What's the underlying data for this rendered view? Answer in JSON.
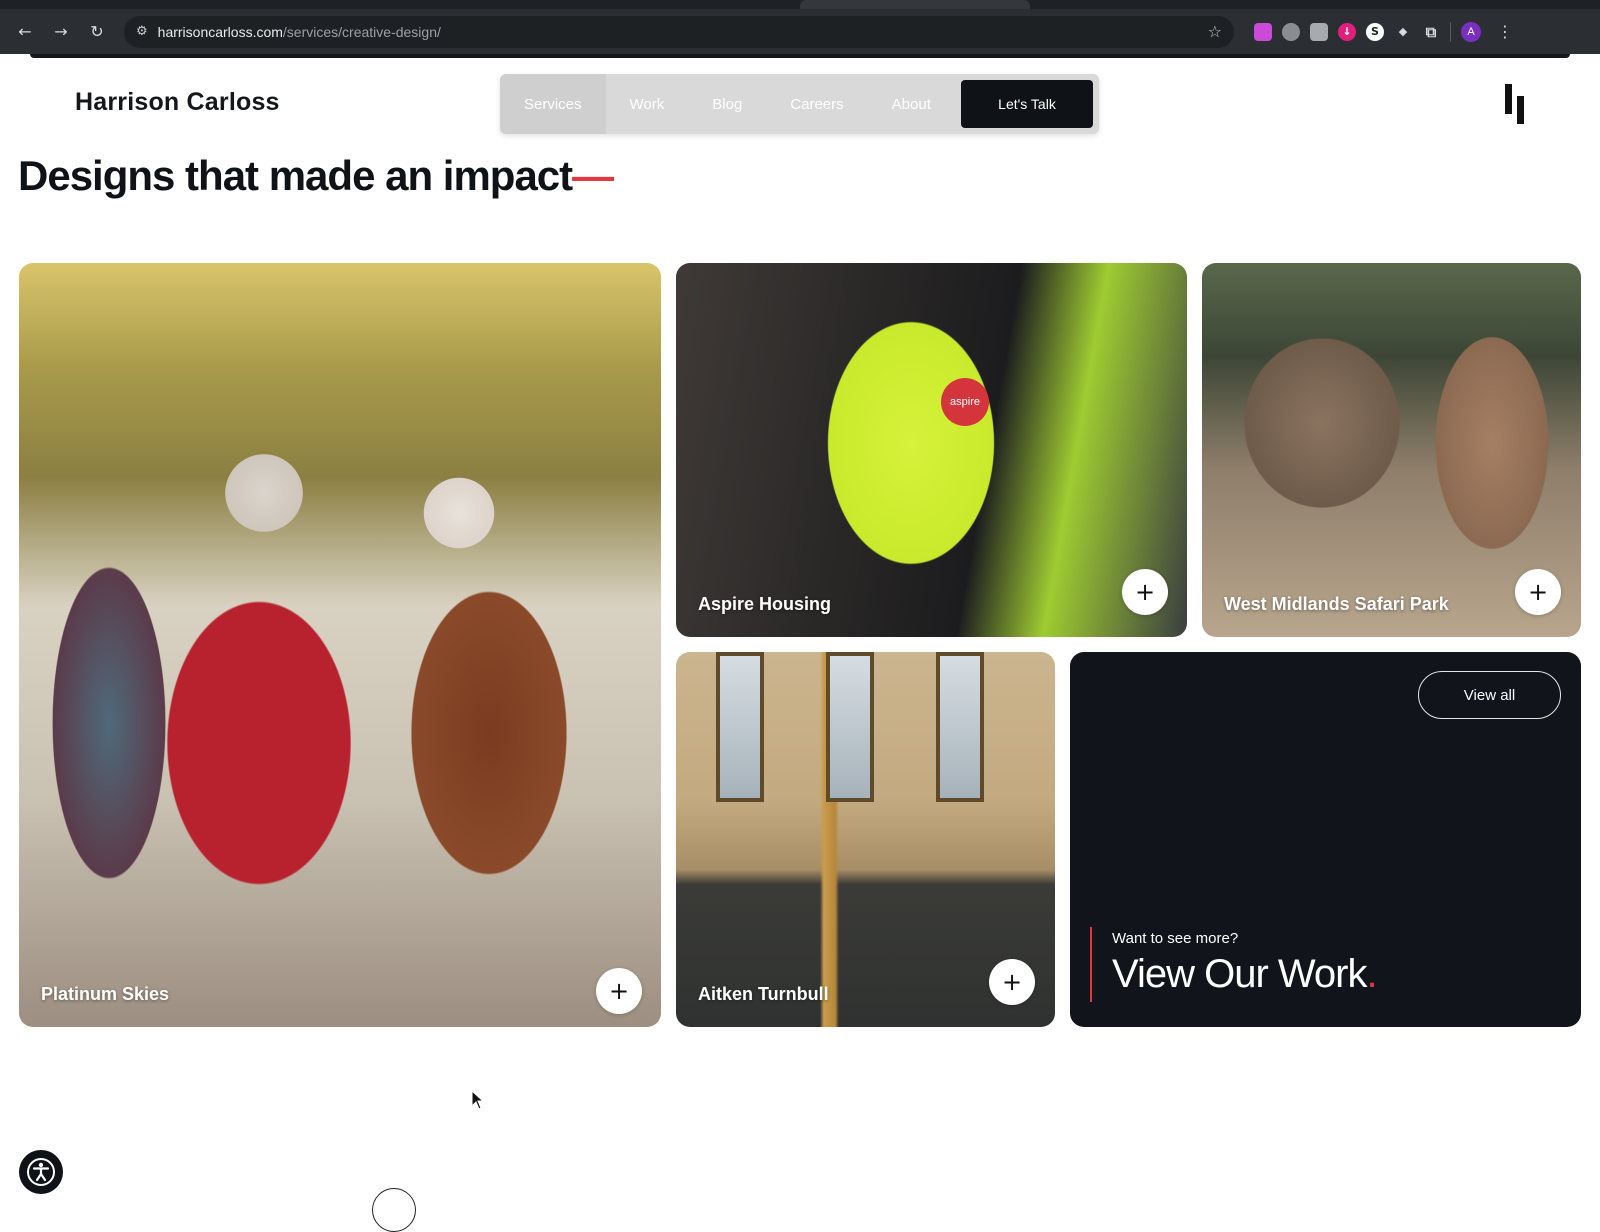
{
  "browser": {
    "url_host": "harrisoncarloss.com",
    "url_path": "/services/creative-design/",
    "avatar_letter": "A"
  },
  "site": {
    "brand": "Harrison Carloss",
    "nav": {
      "items": [
        {
          "label": "Services",
          "active": true
        },
        {
          "label": "Work"
        },
        {
          "label": "Blog"
        },
        {
          "label": "Careers"
        },
        {
          "label": "About"
        }
      ],
      "cta": "Let's Talk"
    }
  },
  "main": {
    "heading": "Designs that made an impact",
    "heading_dash": "—",
    "cards": [
      {
        "label": "Platinum Skies"
      },
      {
        "label": "Aspire Housing",
        "badge": "aspire"
      },
      {
        "label": "West Midlands Safari Park"
      },
      {
        "label": "Aitken Turnbull"
      }
    ],
    "more": {
      "button": "View all",
      "kicker": "Want to see more?",
      "title": "View Our Work",
      "title_dot": "."
    }
  },
  "icons": {
    "back": "←",
    "forward": "→",
    "reload": "↻",
    "star": "☆",
    "plus": "+",
    "kebab": "⋮"
  },
  "colors": {
    "accent": "#e0393e",
    "dark": "#0f1216",
    "nav_bg": "#d9d9d9"
  }
}
